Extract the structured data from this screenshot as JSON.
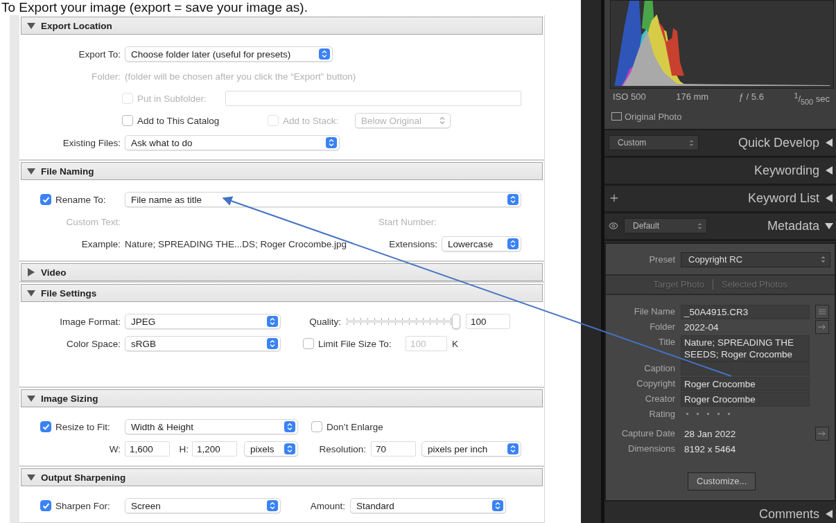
{
  "heading": "To Export your image (export = save your image as).",
  "sections": [
    {
      "title": "Export Location",
      "expanded": true,
      "rows": [
        {
          "items": [
            {
              "kind": "label",
              "text": "Export To:"
            },
            {
              "kind": "select",
              "value": "Choose folder later (useful for presets)"
            }
          ]
        },
        {
          "items": [
            {
              "kind": "label",
              "text": "Folder:",
              "disabled": true
            },
            {
              "kind": "text",
              "text": "(folder will be chosen after you click the “Export” button)",
              "disabled": true
            }
          ]
        },
        {
          "items": [
            {
              "kind": "checkbox",
              "text": "Put in Subfolder:",
              "checked": false,
              "disabled": true
            },
            {
              "kind": "input",
              "disabled": true
            }
          ]
        },
        {
          "items": [
            {
              "kind": "checkbox",
              "text": "Add to This Catalog",
              "checked": false
            },
            {
              "kind": "checkbox",
              "text": "Add to Stack:",
              "checked": false,
              "disabled": true
            },
            {
              "kind": "select",
              "value": "Below Original",
              "disabled": true
            }
          ]
        },
        {
          "items": [
            {
              "kind": "label",
              "text": "Existing Files:"
            },
            {
              "kind": "select",
              "value": "Ask what to do"
            }
          ]
        }
      ]
    },
    {
      "title": "File Naming",
      "expanded": true,
      "rows": [
        {
          "items": [
            {
              "kind": "checkbox",
              "text": "Rename To:",
              "checked": true
            },
            {
              "kind": "select",
              "value": "File name as title"
            }
          ]
        },
        {
          "items": [
            {
              "kind": "label",
              "text": "Custom Text:",
              "disabled": true
            },
            {
              "kind": "label",
              "text": "Start Number:",
              "disabled": true
            }
          ]
        },
        {
          "items": [
            {
              "kind": "label",
              "text": "Example:"
            },
            {
              "kind": "text",
              "text": "Nature; SPREADING THE...DS; Roger Crocombe.jpg"
            },
            {
              "kind": "label",
              "text": "Extensions:"
            },
            {
              "kind": "select",
              "value": "Lowercase"
            }
          ]
        }
      ]
    },
    {
      "title": "Video",
      "expanded": false
    },
    {
      "title": "File Settings",
      "expanded": true,
      "rows": [
        {
          "items": [
            {
              "kind": "label",
              "text": "Image Format:"
            },
            {
              "kind": "select",
              "value": "JPEG"
            },
            {
              "kind": "label",
              "text": "Quality:"
            },
            {
              "kind": "slider",
              "level": 1.0
            },
            {
              "kind": "input",
              "value": "100"
            }
          ]
        },
        {
          "items": [
            {
              "kind": "label",
              "text": "Color Space:"
            },
            {
              "kind": "select",
              "value": "sRGB"
            },
            {
              "kind": "checkbox",
              "text": "Limit File Size To:",
              "checked": false
            },
            {
              "kind": "input",
              "value": "100",
              "disabled": true
            },
            {
              "kind": "text",
              "text": "K"
            }
          ]
        }
      ]
    },
    {
      "title": "Image Sizing",
      "expanded": true,
      "rows": [
        {
          "items": [
            {
              "kind": "checkbox",
              "text": "Resize to Fit:",
              "checked": true
            },
            {
              "kind": "select",
              "value": "Width & Height"
            },
            {
              "kind": "checkbox",
              "text": "Don’t Enlarge",
              "checked": false
            }
          ]
        },
        {
          "items": [
            {
              "kind": "label",
              "text": "W:"
            },
            {
              "kind": "input",
              "value": "1,600"
            },
            {
              "kind": "label",
              "text": "H:"
            },
            {
              "kind": "input",
              "value": "1,200"
            },
            {
              "kind": "select",
              "value": "pixels"
            },
            {
              "kind": "label",
              "text": "Resolution:"
            },
            {
              "kind": "input",
              "value": "70"
            },
            {
              "kind": "select",
              "value": "pixels per inch"
            }
          ]
        }
      ]
    },
    {
      "title": "Output Sharpening",
      "expanded": true,
      "rows": [
        {
          "items": [
            {
              "kind": "checkbox",
              "text": "Sharpen For:",
              "checked": true
            },
            {
              "kind": "select",
              "value": "Screen"
            },
            {
              "kind": "label",
              "text": "Amount:"
            },
            {
              "kind": "select",
              "value": "Standard"
            }
          ]
        }
      ]
    }
  ],
  "histogram": {
    "exif": [
      "ISO 500",
      "176 mm",
      "ƒ / 5.6",
      "$^{1}$/$_{500}$ sec"
    ],
    "original_photo": {
      "label": "Original Photo",
      "checked": false
    }
  },
  "panels": [
    {
      "title": "Quick Develop",
      "expanded": false,
      "kind": "preset",
      "preset": "Custom"
    },
    {
      "title": "Keywording",
      "expanded": false,
      "kind": "plain"
    },
    {
      "title": "Keyword List",
      "expanded": false,
      "kind": "add"
    },
    {
      "title": "Metadata",
      "expanded": true,
      "kind": "visibility",
      "preset": "Default",
      "body": {
        "preset_label": "Preset",
        "preset": "Copyright RC",
        "scopes": [
          "Target Photo",
          "Selected Photos"
        ],
        "fields": [
          {
            "label": "File Name",
            "kind": "box-menu",
            "value": "_50A4915.CR3"
          },
          {
            "label": "Folder",
            "kind": "plain-jump",
            "value": "2022-04"
          },
          {
            "label": "Title",
            "kind": "box",
            "value": "Nature; SPREADING THE SEEDS; Roger Crocombe"
          },
          {
            "label": "Caption",
            "kind": "box"
          },
          {
            "label": "Copyright",
            "kind": "box",
            "value": "Roger Crocombe"
          },
          {
            "label": "Creator",
            "kind": "box",
            "value": "Roger Crocombe"
          },
          {
            "label": "Rating",
            "kind": "rating",
            "stars": 0
          },
          {
            "label": "Capture Date",
            "kind": "plain-jump",
            "value": "28 Jan 2022"
          },
          {
            "label": "Dimensions",
            "kind": "plain",
            "value": "8192 x 5464"
          }
        ],
        "customize": "Customize..."
      }
    },
    {
      "title": "Comments",
      "expanded": false,
      "kind": "plain"
    }
  ]
}
